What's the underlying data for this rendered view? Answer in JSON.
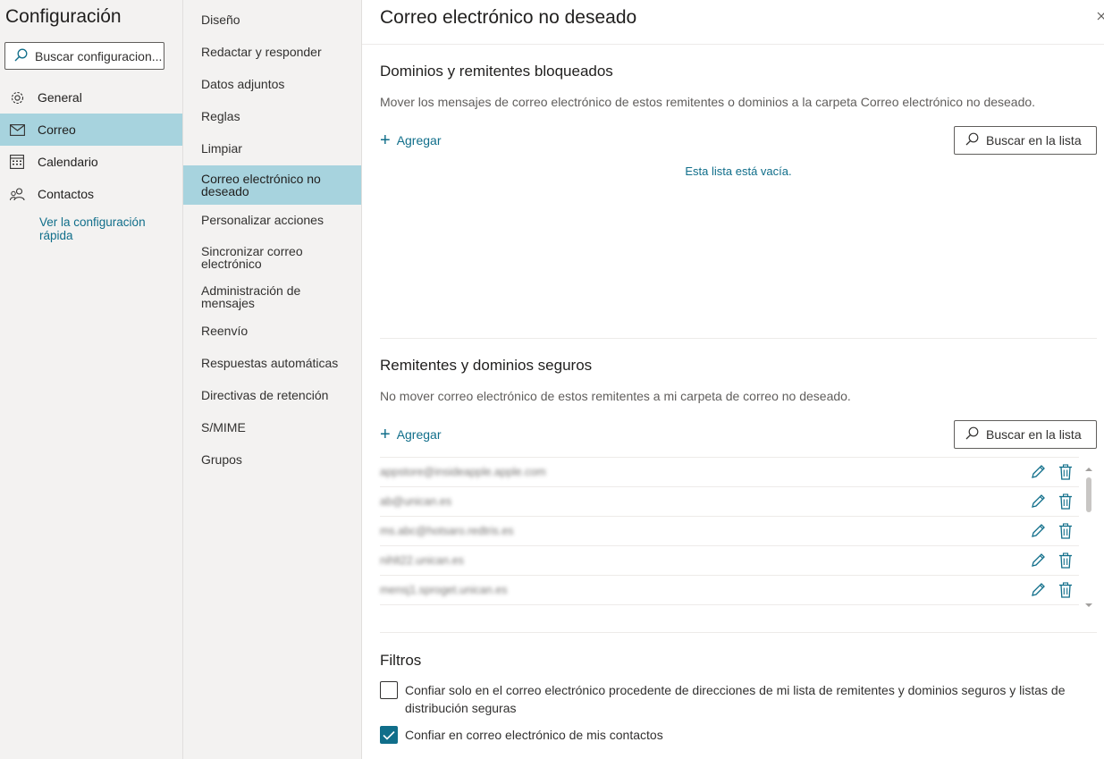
{
  "sidebar": {
    "title": "Configuración",
    "search_placeholder": "Buscar configuracion...",
    "categories": [
      {
        "label": "General",
        "icon": "gear-icon"
      },
      {
        "label": "Correo",
        "icon": "mail-icon"
      },
      {
        "label": "Calendario",
        "icon": "calendar-icon"
      },
      {
        "label": "Contactos",
        "icon": "people-icon"
      }
    ],
    "quick_link": "Ver la configuración rápida"
  },
  "submenu": {
    "items": [
      "Diseño",
      "Redactar y responder",
      "Datos adjuntos",
      "Reglas",
      "Limpiar",
      "Correo electrónico no deseado",
      "Personalizar acciones",
      "Sincronizar correo electrónico",
      "Administración de mensajes",
      "Reenvío",
      "Respuestas automáticas",
      "Directivas de retención",
      "S/MIME",
      "Grupos"
    ],
    "selected": "Correo electrónico no deseado"
  },
  "panel": {
    "title": "Correo electrónico no deseado",
    "blocked": {
      "title": "Dominios y remitentes bloqueados",
      "description": "Mover los mensajes de correo electrónico de estos remitentes o dominios a la carpeta Correo electrónico no deseado.",
      "add_label": "Agregar",
      "search_label": "Buscar en la lista",
      "empty_text": "Esta lista está vacía."
    },
    "safe": {
      "title": "Remitentes y dominios seguros",
      "description": "No mover correo electrónico de estos remitentes a mi carpeta de correo no deseado.",
      "add_label": "Agregar",
      "search_label": "Buscar en la lista",
      "entries": [
        "appstore@insideapple.apple.com",
        "ab@unican.es",
        "ms.abc@hotsaro.redtris.es",
        "nihlt22.unican.es",
        "mensj1.sproget.unican.es"
      ]
    },
    "filters": {
      "title": "Filtros",
      "options": [
        {
          "label": "Confiar solo en el correo electrónico procedente de direcciones de mi lista de remitentes y dominios seguros y listas de distribución seguras",
          "checked": false
        },
        {
          "label": "Confiar en correo electrónico de mis contactos",
          "checked": true
        }
      ]
    }
  },
  "colors": {
    "accent": "#106e8a",
    "selected_bg": "#a7d3de",
    "sidebar_bg": "#f3f2f1"
  }
}
